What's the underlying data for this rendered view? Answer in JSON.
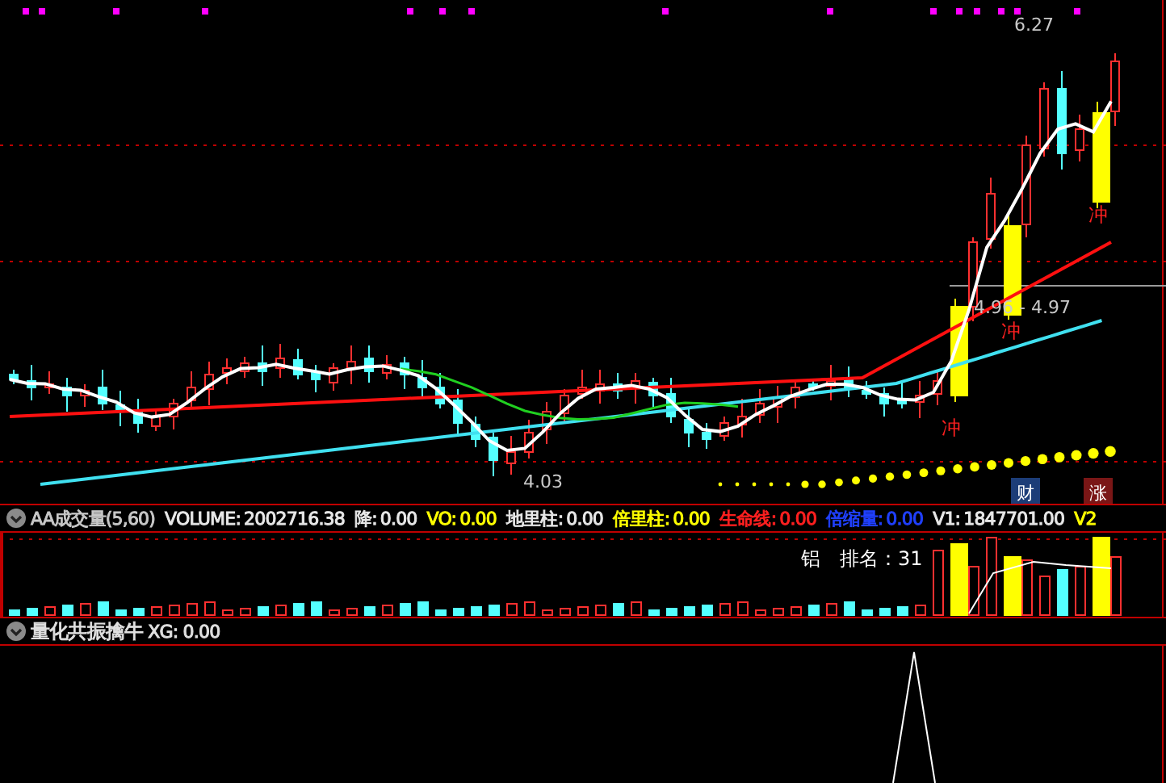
{
  "main_chart": {
    "annotations": [
      {
        "kind": "high",
        "text": "6.27"
      },
      {
        "kind": "range",
        "text": "4.96 - 4.97"
      },
      {
        "kind": "low",
        "text": "4.03"
      }
    ],
    "signals": [
      "冲",
      "冲",
      "冲"
    ],
    "badges": [
      {
        "text": "财",
        "color": "#1c3d78"
      },
      {
        "text": "涨",
        "color": "#7a1616"
      }
    ]
  },
  "volume_panel": {
    "title": "AA成交量(5,60)",
    "header": [
      {
        "label": "VOLUME:",
        "value": "2002716.38",
        "color": "#e8e8e8"
      },
      {
        "label": "降:",
        "value": "0.00",
        "color": "#e8e8e8"
      },
      {
        "label": "VO:",
        "value": "0.00",
        "color": "#ffff00"
      },
      {
        "label": "地里柱:",
        "value": "0.00",
        "color": "#e8e8e8"
      },
      {
        "label": "倍里柱:",
        "value": "0.00",
        "color": "#ffff00"
      },
      {
        "label": "生命线:",
        "value": "0.00",
        "color": "#ff2020"
      },
      {
        "label": "倍缩量:",
        "value": "0.00",
        "color": "#2040ff"
      },
      {
        "label": "V1:",
        "value": "1847701.00",
        "color": "#e8e8e8"
      },
      {
        "label": "V2",
        "color": "#ffff00"
      }
    ],
    "sector": "铝",
    "rank": "排名：31"
  },
  "signal_panel": {
    "title": "量化共振擒牛",
    "reading": "XG: 0.00"
  }
}
